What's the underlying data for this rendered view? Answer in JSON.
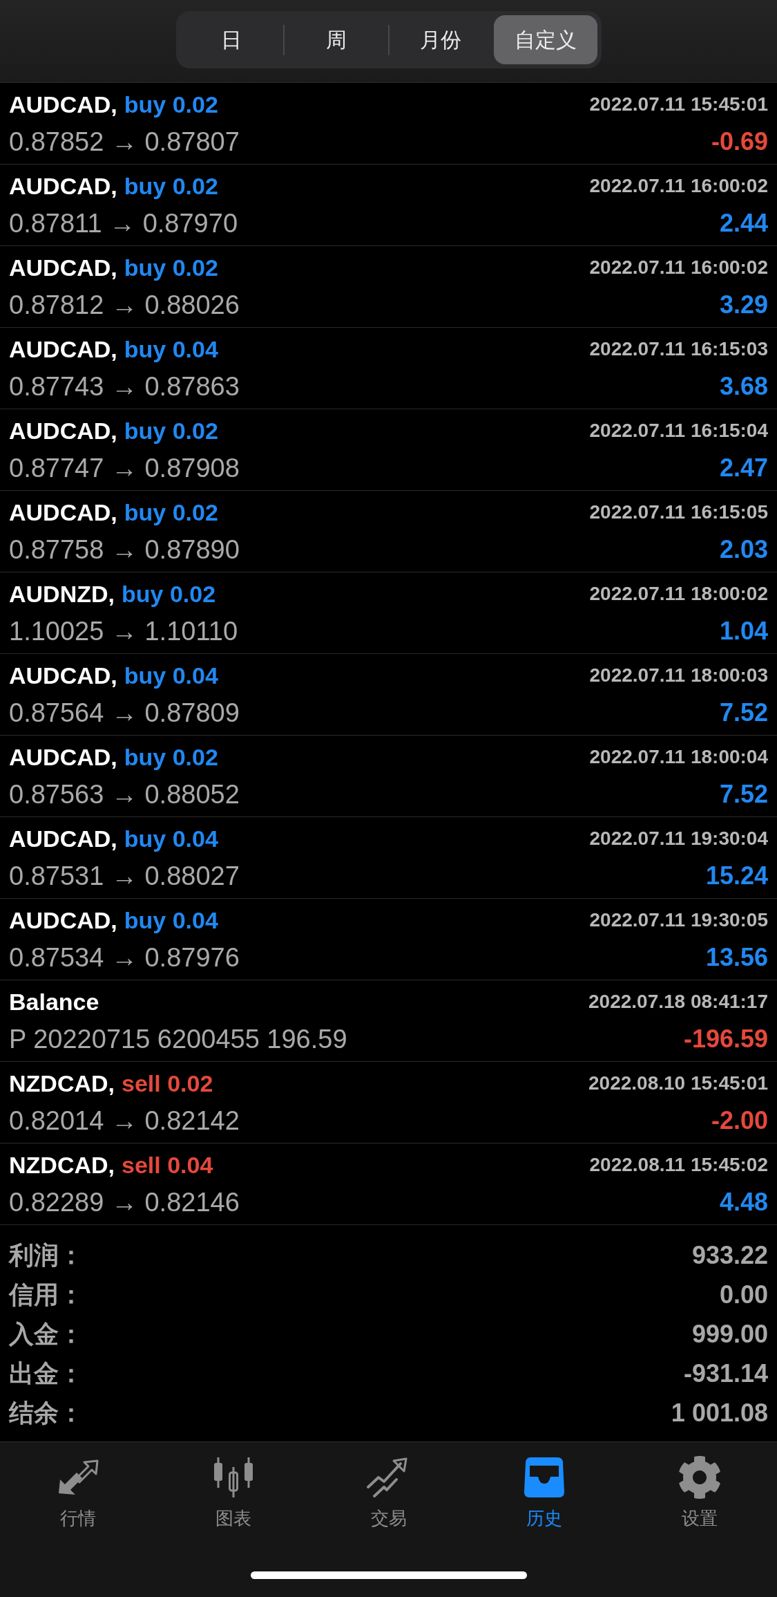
{
  "segments": [
    {
      "label": "日",
      "selected": false
    },
    {
      "label": "周",
      "selected": false
    },
    {
      "label": "月份",
      "selected": false
    },
    {
      "label": "自定义",
      "selected": true
    }
  ],
  "deals": [
    {
      "kind": "buy",
      "symbol": "AUDCAD,",
      "order": "buy 0.02",
      "time": "2022.07.11 15:45:01",
      "prices": "0.87852 → 0.87807",
      "profit": "-0.69",
      "loss": true
    },
    {
      "kind": "buy",
      "symbol": "AUDCAD,",
      "order": "buy 0.02",
      "time": "2022.07.11 16:00:02",
      "prices": "0.87811 → 0.87970",
      "profit": "2.44",
      "loss": false
    },
    {
      "kind": "buy",
      "symbol": "AUDCAD,",
      "order": "buy 0.02",
      "time": "2022.07.11 16:00:02",
      "prices": "0.87812 → 0.88026",
      "profit": "3.29",
      "loss": false
    },
    {
      "kind": "buy",
      "symbol": "AUDCAD,",
      "order": "buy 0.04",
      "time": "2022.07.11 16:15:03",
      "prices": "0.87743 → 0.87863",
      "profit": "3.68",
      "loss": false
    },
    {
      "kind": "buy",
      "symbol": "AUDCAD,",
      "order": "buy 0.02",
      "time": "2022.07.11 16:15:04",
      "prices": "0.87747 → 0.87908",
      "profit": "2.47",
      "loss": false
    },
    {
      "kind": "buy",
      "symbol": "AUDCAD,",
      "order": "buy 0.02",
      "time": "2022.07.11 16:15:05",
      "prices": "0.87758 → 0.87890",
      "profit": "2.03",
      "loss": false
    },
    {
      "kind": "buy",
      "symbol": "AUDNZD,",
      "order": "buy 0.02",
      "time": "2022.07.11 18:00:02",
      "prices": "1.10025 → 1.10110",
      "profit": "1.04",
      "loss": false
    },
    {
      "kind": "buy",
      "symbol": "AUDCAD,",
      "order": "buy 0.04",
      "time": "2022.07.11 18:00:03",
      "prices": "0.87564 → 0.87809",
      "profit": "7.52",
      "loss": false
    },
    {
      "kind": "buy",
      "symbol": "AUDCAD,",
      "order": "buy 0.02",
      "time": "2022.07.11 18:00:04",
      "prices": "0.87563 → 0.88052",
      "profit": "7.52",
      "loss": false
    },
    {
      "kind": "buy",
      "symbol": "AUDCAD,",
      "order": "buy 0.04",
      "time": "2022.07.11 19:30:04",
      "prices": "0.87531 → 0.88027",
      "profit": "15.24",
      "loss": false
    },
    {
      "kind": "buy",
      "symbol": "AUDCAD,",
      "order": "buy 0.04",
      "time": "2022.07.11 19:30:05",
      "prices": "0.87534 → 0.87976",
      "profit": "13.56",
      "loss": false
    },
    {
      "kind": "balance",
      "symbol": "Balance",
      "time": "2022.07.18 08:41:17",
      "prices": "P 20220715 6200455 196.59",
      "profit": "-196.59",
      "loss": true
    },
    {
      "kind": "sell",
      "symbol": "NZDCAD,",
      "order": "sell 0.02",
      "time": "2022.08.10 15:45:01",
      "prices": "0.82014 → 0.82142",
      "profit": "-2.00",
      "loss": true
    },
    {
      "kind": "sell",
      "symbol": "NZDCAD,",
      "order": "sell 0.04",
      "time": "2022.08.11 15:45:02",
      "prices": "0.82289 → 0.82146",
      "profit": "4.48",
      "loss": false
    }
  ],
  "summary": [
    {
      "label": "利润：",
      "value": "933.22"
    },
    {
      "label": "信用：",
      "value": "0.00"
    },
    {
      "label": "入金：",
      "value": "999.00"
    },
    {
      "label": "出金：",
      "value": "-931.14"
    },
    {
      "label": "结余：",
      "value": "1 001.08"
    }
  ],
  "tabs": [
    {
      "label": "行情",
      "selected": false
    },
    {
      "label": "图表",
      "selected": false
    },
    {
      "label": "交易",
      "selected": false
    },
    {
      "label": "历史",
      "selected": true
    },
    {
      "label": "设置",
      "selected": false
    }
  ]
}
